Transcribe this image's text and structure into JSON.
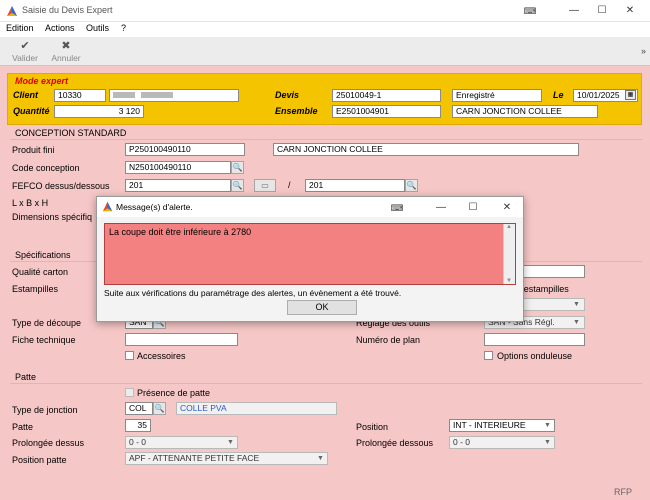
{
  "window": {
    "title": "Saisie du Devis Expert"
  },
  "menu": {
    "items": [
      "Edition",
      "Actions",
      "Outils",
      "?"
    ]
  },
  "toolbar": {
    "validate": "Valider",
    "cancel": "Annuler",
    "more": "»"
  },
  "expert": {
    "mode_label": "Mode expert",
    "client_label": "Client",
    "client_code": "10330",
    "client_name": "",
    "devis_label": "Devis",
    "devis_value": "25010049-1",
    "status_value": "Enregistré",
    "date_label": "Le",
    "date_value": "10/01/2025",
    "quantite_label": "Quantité",
    "quantite_value": "3 120",
    "ensemble_label": "Ensemble",
    "ensemble_code": "E2501004901",
    "ensemble_name": "CARN JONCTION COLLEE"
  },
  "conception": {
    "title": "CONCEPTION STANDARD",
    "produit_label": "Produit fini",
    "produit_code": "P250100490110",
    "produit_name": "CARN JONCTION COLLEE",
    "code_label": "Code conception",
    "code_value": "N250100490110",
    "fefco_label": "FEFCO dessus/dessous",
    "fefco_top": "201",
    "fefco_sep": "/",
    "fefco_bottom": "201",
    "lxbxh_label": "L x B x H",
    "dim_label": "Dimensions spécifiq"
  },
  "specs": {
    "title": "Spécifications",
    "qualite_label": "Qualité carton",
    "estampilles_label": "Estampilles",
    "estampilles_right": "'estampilles",
    "decoupe_label": "Type de découpe",
    "decoupe_value": "SAN",
    "reglage_label": "Réglage des outils",
    "reglage_value": "SAN - Sans Régl.",
    "fiche_label": "Fiche technique",
    "plan_label": "Numéro de plan",
    "accessoires_label": "Accessoires",
    "options_label": "Options onduleuse"
  },
  "patte": {
    "title": "Patte",
    "presence_label": "Présence de patte",
    "jonction_label": "Type de jonction",
    "jonction_code": "COL",
    "jonction_name": "COLLE PVA",
    "patte_label": "Patte",
    "patte_value": "35",
    "position_label": "Position",
    "position_value": "INT - INTERIEURE",
    "prolongee_dessus_label": "Prolongée dessus",
    "prolongee_dessus_value": "0 - 0",
    "prolongee_dessous_label": "Prolongée dessous",
    "prolongee_dessous_value": "0 - 0",
    "position_patte_label": "Position patte",
    "position_patte_value": "APF - ATTENANTE PETITE FACE"
  },
  "dialog": {
    "title": "Message(s) d'alerte.",
    "message": "La coupe doit être inférieure à 2780",
    "info": "Suite aux vérifications du paramétrage des alertes, un évènement a été trouvé.",
    "ok": "OK"
  },
  "footer": {
    "text": "RFP"
  },
  "colors": {
    "form_bg": "#f6c7c7",
    "expert_bg": "#f5c400",
    "alert_bg": "#f48181",
    "mode_red": "#dd0000"
  }
}
